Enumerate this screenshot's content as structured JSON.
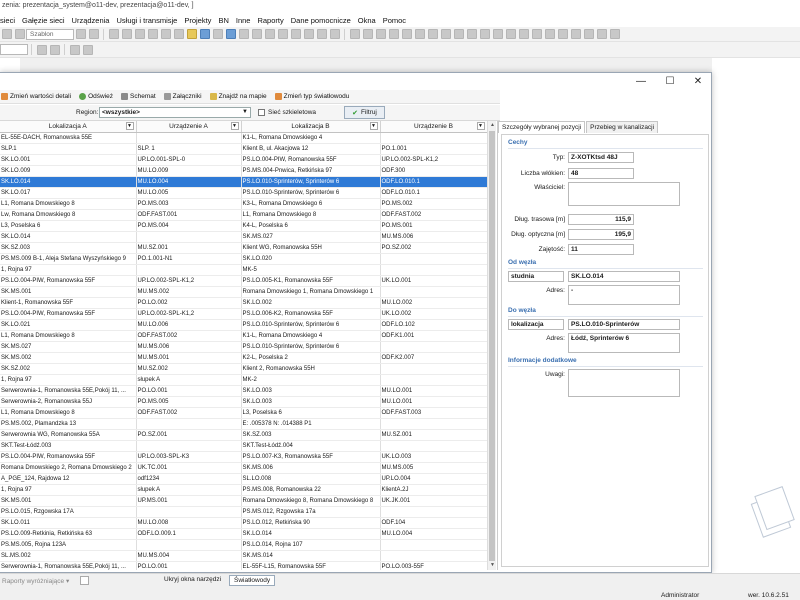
{
  "app": {
    "title": "zenia: prezentacja_system@o11-dev, prezentacja@o11-dev, ]"
  },
  "menu": [
    "sieci",
    "Gałęzie sieci",
    "Urządzenia",
    "Usługi i transmisje",
    "Projekty",
    "BN",
    "Inne",
    "Raporty",
    "Dane pomocnicze",
    "Okna",
    "Pomoc"
  ],
  "toolbar": {
    "template_combo": "Szablon"
  },
  "window": {
    "controls": {
      "minimize": "—",
      "maximize": "☐",
      "close": "✕"
    },
    "tools": [
      {
        "label": "Zmień wartości detali",
        "icon": "edit-icon"
      },
      {
        "label": "Odśwież",
        "icon": "refresh-icon"
      },
      {
        "label": "Schemat",
        "icon": "schema-icon"
      },
      {
        "label": "Załączniki",
        "icon": "attachment-icon"
      },
      {
        "label": "Znajdź na mapie",
        "icon": "map-icon"
      },
      {
        "label": "Zmień typ światłowodu",
        "icon": "edit-icon"
      }
    ],
    "filter": {
      "region_label": "Region:",
      "region_value": "<wszystkie>",
      "backbone_label": "Sieć szkieletowa",
      "filter_button": "Filtruj"
    }
  },
  "table": {
    "columns": [
      "Lokalizacja A",
      "Urządzenie A",
      "Lokalizacja B",
      "Urządzenie B"
    ],
    "selected_index": 4,
    "rows": [
      [
        "EL-55E-DACH, Romanowska 55E",
        "",
        "K1-L, Romana Dmowskiego 4",
        ""
      ],
      [
        "SLP.1",
        "SLP. 1",
        "Klient B, ul. Akacjowa 12",
        "PO.1.001"
      ],
      [
        "SK.LO.001",
        "UP.LO.001-SPL-0",
        "PS.LO.004-PIW, Romanowska 55F",
        "UP.LO.002-SPL-K1,2"
      ],
      [
        "SK.LO.009",
        "MU.LO.009",
        "PS.MS.004-Pnwica, Retkińska 97",
        "ODF.300"
      ],
      [
        "SK.LO.014",
        "MU.LO.004",
        "PS.LO.010-Sprinterów, Sprinterów 6",
        "ODF.LO.010.1"
      ],
      [
        "SK.LO.017",
        "MU.LO.005",
        "PS.LO.010-Sprinterów, Sprinterów 6",
        "ODF.LO.010.1"
      ],
      [
        "L1, Romana Dmowskiego 8",
        "PO.MS.003",
        "K3-L, Romana Dmowskiego 6",
        "PO.MS.002"
      ],
      [
        "Lw, Romana Dmowskiego 8",
        "ODF.FAST.001",
        "L1, Romana Dmowskiego 8",
        "ODF.FAST.002"
      ],
      [
        "L3, Poselska 6",
        "PO.MS.004",
        "K4-L, Poselska 6",
        "PO.MS.001"
      ],
      [
        "SK.LO.014",
        "",
        "SK.MS.027",
        "MU.MS.006"
      ],
      [
        "SK.SZ.003",
        "MU.SZ.001",
        "Klient WG, Romanowska 55H",
        "PO.SZ.002"
      ],
      [
        "PS.MS.009 B-1, Aleja Stefana Wyszyńskiego 9",
        "PO.1.001-N1",
        "SK.LO.020",
        ""
      ],
      [
        "1, Rojna 97",
        "",
        "MK-5",
        ""
      ],
      [
        "PS.LO.004-PIW, Romanowska 55F",
        "UP.LO.002-SPL-K1,2",
        "PS.LO.005-K1, Romanowska 55F",
        "UK.LO.001"
      ],
      [
        "SK.MS.001",
        "MU.MS.002",
        "Romana Dmowskiego 1, Romana Dmowskiego 1",
        ""
      ],
      [
        "Klient-1, Romanowska 55F",
        "PO.LO.002",
        "SK.LO.002",
        "MU.LO.002"
      ],
      [
        "PS.LO.004-PIW, Romanowska 55F",
        "UP.LO.002-SPL-K1,2",
        "PS.LO.006-K2, Romanowska 55F",
        "UK.LO.002"
      ],
      [
        "SK.LO.021",
        "MU.LO.006",
        "PS.LO.010-Sprinterów, Sprinterów 6",
        "ODF.LO.102"
      ],
      [
        "L1, Romana Dmowskiego 8",
        "ODF.FAST.002",
        "K1-L, Romana Dmowskiego 4",
        "ODF.K1.001"
      ],
      [
        "SK.MS.027",
        "MU.MS.006",
        "PS.LO.010-Sprinterów, Sprinterów 6",
        ""
      ],
      [
        "SK.MS.002",
        "MU.MS.001",
        "K2-L, Poselska 2",
        "ODF.K2.007"
      ],
      [
        "SK.SZ.002",
        "MU.SZ.002",
        "Klient 2, Romanowska 55H",
        ""
      ],
      [
        "1, Rojna 97",
        "słupek A",
        "MK-2",
        ""
      ],
      [
        "Serwerownia-1, Romanowska 55E,Pokój 11, ...",
        "PO.LO.001",
        "SK.LO.003",
        "MU.LO.001"
      ],
      [
        "Serwerownia-2, Romanowska 55J",
        "PO.MS.005",
        "SK.LO.003",
        "MU.LO.001"
      ],
      [
        "L1, Romana Dmowskiego 8",
        "ODF.FAST.002",
        "L3, Poselska 6",
        "ODF.FAST.003"
      ],
      [
        "PS.MS.002, Plamandzka 13",
        "",
        "E: .005378  N: .014388    P1",
        ""
      ],
      [
        "Serwerownia WG, Romanowska 55A",
        "PO.SZ.001",
        "SK.SZ.003",
        "MU.SZ.001"
      ],
      [
        "SKT.Test-Łódź.003",
        "",
        "SKT.Test-Łódź.004",
        ""
      ],
      [
        "PS.LO.004-PIW, Romanowska 55F",
        "UP.LO.003-SPL-K3",
        "PS.LO.007-K3, Romanowska 55F",
        "UK.LO.003"
      ],
      [
        "Romana Dmowskiego 2, Romana Dmowskiego 2",
        "UK.TC.001",
        "SK.MS.006",
        "MU.MS.005"
      ],
      [
        "A_PGE_124, Rajdowa 12",
        "odf1234",
        "SL.LO.008",
        "UP.LO.004"
      ],
      [
        "1, Rojna 97",
        "słupek A",
        "PS.MS.008, Romanowska 22",
        "KlientA.2J"
      ],
      [
        "SK.MS.001",
        "UP.MS.001",
        "Romana Dmowskiego 8, Romana Dmowskiego 8",
        "UK.JK.001"
      ],
      [
        "PS.LO.015, Rzgowska 17A",
        "",
        "PS.MS.012, Rzgowska 17a",
        ""
      ],
      [
        "SK.LO.011",
        "MU.LO.008",
        "PS.LO.012, Retkińska 90",
        "ODF.104"
      ],
      [
        "PS.LO.009-Retkinia, Retkińska 63",
        "ODF.LO.009.1",
        "SK.LO.014",
        "MU.LO.004"
      ],
      [
        "PS.MS.005, Rojna 123A",
        "",
        "PS.LO.014, Rojna 107",
        ""
      ],
      [
        "SL.MS.002",
        "MU.MS.004",
        "SK.MS.014",
        ""
      ],
      [
        "Serwerownia-1, Romanowska 55E,Pokój 11, ...",
        "PO.LO.001",
        "EL-55F-L15, Romanowska 55F",
        "PO.LO.003-55F"
      ]
    ]
  },
  "detail": {
    "tabs": [
      "Szczegóły wybranej pozycji",
      "Przebieg w kanalizacji"
    ],
    "sections": {
      "features": "Cechy",
      "from_node": "Od węzła",
      "to_node": "Do węzła",
      "extra": "Informacje dodatkowe"
    },
    "fields": {
      "type_label": "Typ:",
      "type_value": "Z-XOTKtsd 48J",
      "fibers_label": "Liczba włókien:",
      "fibers_value": "48",
      "owner_label": "Właściciel:",
      "owner_value": "",
      "route_length_label": "Dług. trasowa [m]",
      "route_length_value": "115,9",
      "optical_length_label": "Dług. optyczna [m]",
      "optical_length_value": "195,9",
      "occupancy_label": "Zajętość:",
      "occupancy_value": "11",
      "from_kind": "studnia",
      "from_name": "SK.LO.014",
      "from_address_label": "Adres:",
      "from_address_value": "-",
      "to_kind": "lokalizacja",
      "to_name": "PS.LO.010-Sprinterów",
      "to_address_label": "Adres:",
      "to_address_value": "Łódź, Sprinterów 6",
      "notes_label": "Uwagi:",
      "notes_value": ""
    }
  },
  "bottom": {
    "reports_label": "Raporty wyróżniające ▾",
    "hide_tools_button": "Ukryj okna narzędzi",
    "fiber_tab": "Światłowody",
    "user": "Administrator",
    "version": "wer. 10.6.2.51"
  }
}
